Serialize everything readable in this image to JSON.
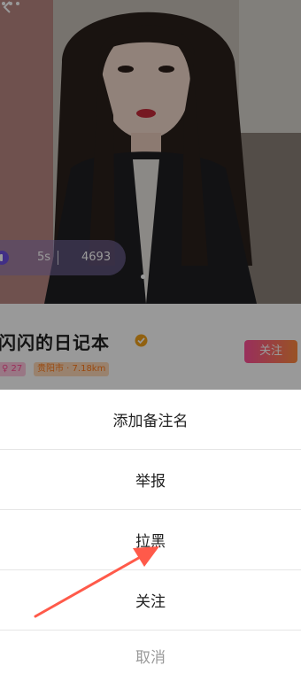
{
  "profile": {
    "nickname": "闪闪的日记本",
    "voice_length": "5s",
    "like_count": "4693",
    "tag_age": "27",
    "tag_city": "贵阳市 · 7.18km",
    "follow_label": "关注"
  },
  "action_sheet": {
    "items": [
      {
        "label": "添加备注名"
      },
      {
        "label": "举报"
      },
      {
        "label": "拉黑"
      },
      {
        "label": "关注"
      }
    ],
    "cancel_label": "取消"
  },
  "annotation": {
    "arrow_color": "#ff5a4a",
    "points_to": "拉黑"
  },
  "colors": {
    "pill_bg": "#8c78be",
    "follow_gradient_start": "#ff4f9a",
    "follow_gradient_end": "#ff8a3d",
    "cancel_text": "#9a9a9a"
  }
}
